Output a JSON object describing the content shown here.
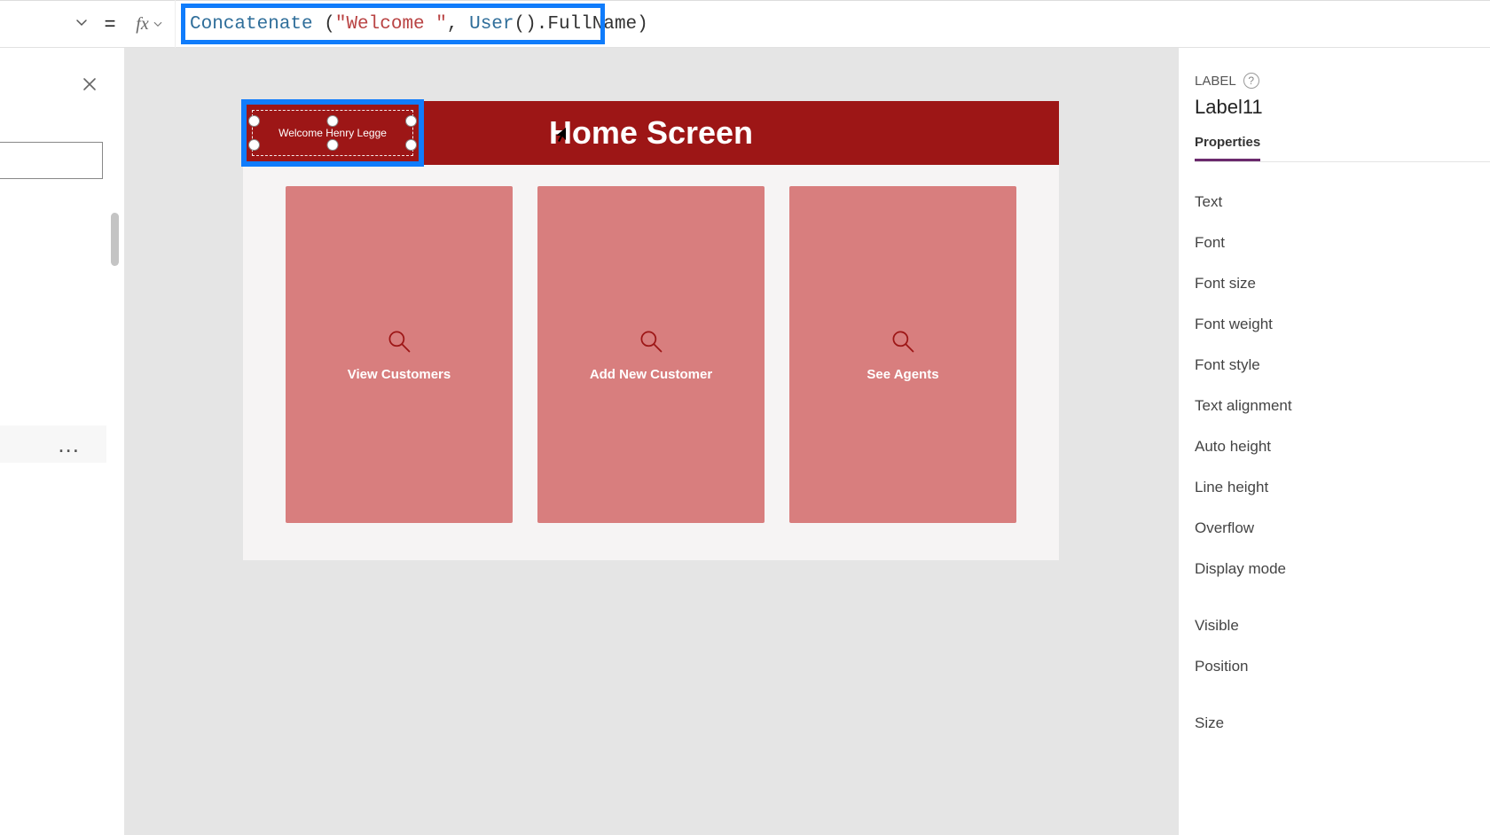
{
  "formulaBar": {
    "equals": "=",
    "fx": "fx",
    "tokens": {
      "fn": "Concatenate",
      "space_open": " (",
      "str": "\"Welcome \"",
      "comma": ", ",
      "userfn": "User",
      "parens": "()",
      "dot": ".",
      "prop": "FullName",
      "close": ")"
    }
  },
  "leftSidebar": {
    "ellipsis": "..."
  },
  "canvas": {
    "headerTitle": "Home Screen",
    "welcomeLabel": "Welcome Henry Legge",
    "cards": [
      {
        "label": "View Customers"
      },
      {
        "label": "Add New Customer"
      },
      {
        "label": "See Agents"
      }
    ]
  },
  "propsPanel": {
    "typeLabel": "LABEL",
    "help": "?",
    "controlName": "Label11",
    "tab": "Properties",
    "rows": [
      "Text",
      "Font",
      "Font size",
      "Font weight",
      "Font style",
      "Text alignment",
      "Auto height",
      "Line height",
      "Overflow",
      "Display mode"
    ],
    "rowsB": [
      "Visible",
      "Position"
    ],
    "rowsC": [
      "Size"
    ]
  }
}
